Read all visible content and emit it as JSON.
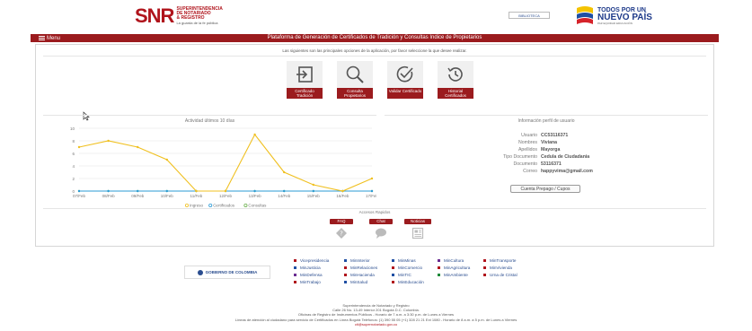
{
  "header": {
    "snr_mark": "SNR",
    "snr_lines": [
      "SUPERINTENDENCIA",
      "DE NOTARIADO",
      "& REGISTRO"
    ],
    "snr_sub": "La guarda de la fe pública",
    "search_label": "BIBLIOTECA",
    "todos_l1": "TODOS POR UN",
    "todos_l2": "NUEVO PAÍS",
    "todos_l3": "PAZ   EQUIDAD   EDUCACIÓN"
  },
  "navbar": {
    "menu_label": "Menu",
    "title": "Plataforma de Generación de Certificados de Tradición y Consultas Indice de Propietarios"
  },
  "main": {
    "intro": "Las siguientes son las principales opciones de la aplicación, por favor seleccione la que desee realizar.",
    "actions": [
      {
        "label": "Certificado Tradición",
        "icon": "sign-in-icon"
      },
      {
        "label": "Consulta Propietarios",
        "icon": "search-icon"
      },
      {
        "label": "Validar Certificado",
        "icon": "check-circle-icon"
      },
      {
        "label": "Historial Certificados",
        "icon": "history-icon"
      }
    ]
  },
  "chart_panel": {
    "title": "Actividad últimos 10 días"
  },
  "chart_data": {
    "type": "line",
    "title": "Actividad últimos 10 días",
    "categories": [
      "07/Feb",
      "08/Feb",
      "09/Feb",
      "10/Feb",
      "11/Feb",
      "12/Feb",
      "13/Feb",
      "14/Feb",
      "15/Feb",
      "16/Feb",
      "17/Feb"
    ],
    "ylim": [
      0,
      10
    ],
    "yticks": [
      0,
      2,
      4,
      6,
      8,
      10
    ],
    "grid": true,
    "legend_position": "bottom",
    "series": [
      {
        "name": "Ingreso",
        "color": "#f0c020",
        "values": [
          7,
          8,
          7,
          5,
          0,
          0,
          9,
          3,
          1,
          0,
          2
        ]
      },
      {
        "name": "Certificados",
        "color": "#2b9bd6",
        "values": [
          0,
          0,
          0,
          0,
          0,
          0,
          0,
          0,
          0,
          0,
          0
        ]
      },
      {
        "name": "Consultas",
        "color": "#6ab04c",
        "values": [
          0,
          0,
          0,
          0,
          0,
          0,
          0,
          0,
          0,
          0,
          0
        ]
      }
    ]
  },
  "profile": {
    "title": "Información perfil de usuario",
    "rows": [
      {
        "key": "Usuario",
        "value": "CC53116371"
      },
      {
        "key": "Nombres",
        "value": "Viviana"
      },
      {
        "key": "Apellidos",
        "value": "Mayorga"
      },
      {
        "key": "Tipo Documento",
        "value": "Cedula de Ciudadania"
      },
      {
        "key": "Documento",
        "value": "53116371"
      },
      {
        "key": "Correo",
        "value": "happyvima@gmail.com"
      }
    ],
    "button_label": "Cuenta Prepago / Cupos"
  },
  "quick_access": {
    "title": "Accesos Rapidos",
    "items": [
      {
        "label": "FAQ",
        "icon": "question-icon"
      },
      {
        "label": "Chat",
        "icon": "chat-icon"
      },
      {
        "label": "Noticias",
        "icon": "news-icon"
      }
    ]
  },
  "footer": {
    "gov_label": "GOBIERNO DE COLOMBIA",
    "links_col1": [
      "Vicepresidencia",
      "MinJusticia",
      "MinDefensa",
      "MinTrabajo"
    ],
    "links_col2": [
      "MinInterior",
      "MinRelaciones",
      "MinHacienda",
      "MinSalud"
    ],
    "links_col3": [
      "MinMinas",
      "MinComercio",
      "MinTIC",
      "MinEducación"
    ],
    "links_col4": [
      "MinCultura",
      "MinAgricultura",
      "MinAmbiente"
    ],
    "links_col5": [
      "MinTransporte",
      "MinVivienda",
      "Urna de Cristal"
    ],
    "info": [
      "Superintendencia de Notariado y Registro",
      "Calle 26 No. 13-49 Interior 201 Bogotá D.C. Colombia.",
      "Oficinas de Registro de Instrumentos Públicos - Horario de 7 a.m. a 3:30 p.m. de Lunes a Viernes",
      "Líneas de atención al ciudadano para servicio de Certificados en Línea Bogotá Teléfonos: (1) 390 55 05 (+1) 328 21 21 Ext 1080 - Horario de 8 a.m. a 5 p.m. de Lunes a Viernes"
    ],
    "email": "ctl@supernotariado.gov.co"
  }
}
